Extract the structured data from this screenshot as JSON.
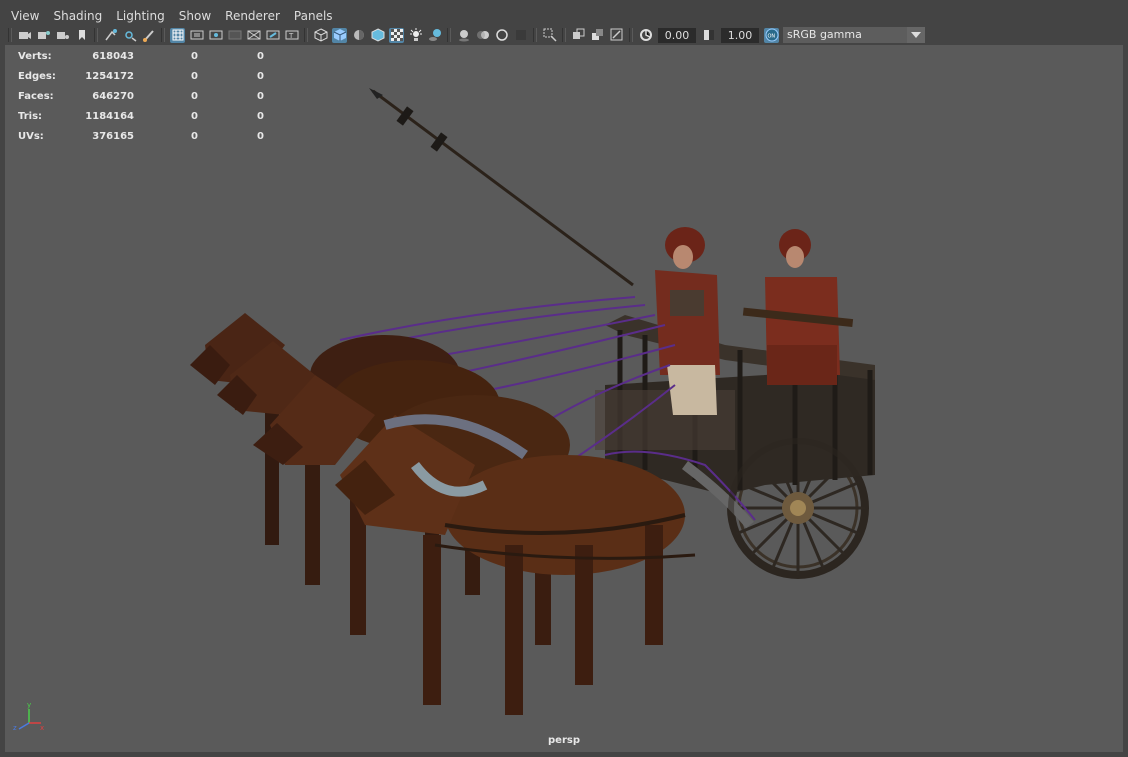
{
  "menu": {
    "items": [
      "View",
      "Shading",
      "Lighting",
      "Show",
      "Renderer",
      "Panels"
    ]
  },
  "toolbar": {
    "exposure_value": "0.00",
    "gamma_value": "1.00",
    "color_space": "sRGB gamma",
    "icons": [
      "camera-icon",
      "camera-attributes-icon",
      "bookmark-icon",
      "image-plane-icon",
      "grid-icon",
      "film-gate-icon",
      "resolution-gate-icon",
      "gate-mask-icon",
      "field-chart-icon",
      "safe-action-icon",
      "safe-title-icon",
      "wireframe-icon",
      "smooth-shade-icon",
      "default-material-icon",
      "textured-icon",
      "use-lights-icon",
      "shadows-icon",
      "ambient-occlusion-icon",
      "motion-blur-icon",
      "anti-aliasing-icon",
      "depth-of-field-icon",
      "isolate-select-icon",
      "xray-icon",
      "xray-joints-icon",
      "backface-culling-icon",
      "exposure-icon",
      "gamma-icon",
      "color-management-icon"
    ]
  },
  "stats": [
    {
      "label": "Verts:",
      "v1": "618043",
      "v2": "0",
      "v3": "0"
    },
    {
      "label": "Edges:",
      "v1": "1254172",
      "v2": "0",
      "v3": "0"
    },
    {
      "label": "Faces:",
      "v1": "646270",
      "v2": "0",
      "v3": "0"
    },
    {
      "label": "Tris:",
      "v1": "1184164",
      "v2": "0",
      "v3": "0"
    },
    {
      "label": "UVs:",
      "v1": "376165",
      "v2": "0",
      "v3": "0"
    }
  ],
  "viewport": {
    "camera_label": "persp",
    "background_color": "#5a5a5a",
    "axis_labels": {
      "x": "x",
      "y": "y",
      "z": "z"
    }
  },
  "colors": {
    "accent": "#5285a6",
    "panel": "#444444",
    "horse": "#4a2515",
    "chariot": "#2e2720",
    "armor": "#7a2a1c",
    "reins": "#6a3a9a"
  }
}
